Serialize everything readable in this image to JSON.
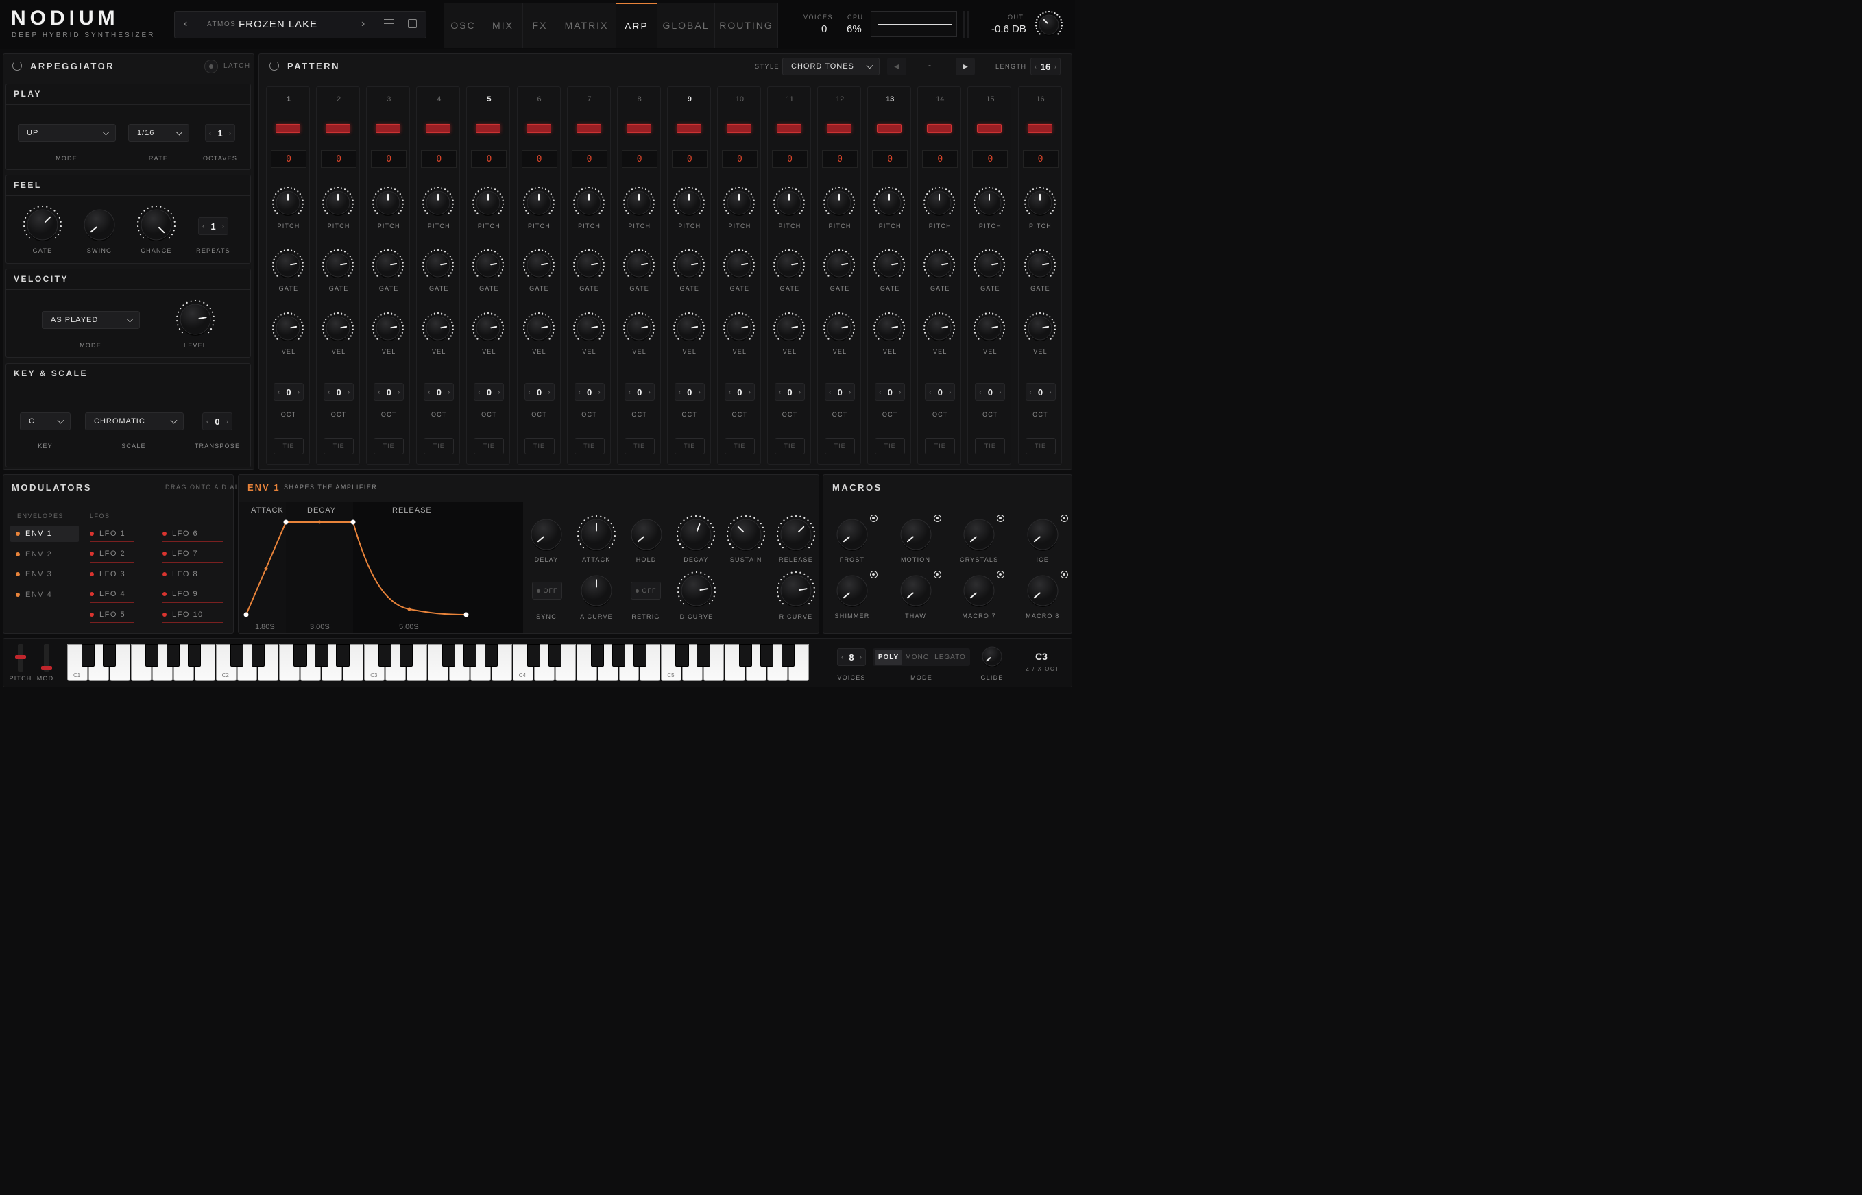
{
  "app": {
    "logo": "NODIUM",
    "subtitle": "DEEP HYBRID SYNTHESIZER"
  },
  "preset": {
    "category": "ATMOS",
    "name": "FROZEN LAKE"
  },
  "nav": {
    "tabs": [
      "OSC",
      "MIX",
      "FX",
      "MATRIX",
      "ARP",
      "GLOBAL",
      "ROUTING"
    ],
    "active": "ARP"
  },
  "meters": {
    "voices_label": "VOICES",
    "voices": "0",
    "cpu_label": "CPU",
    "cpu": "6%",
    "out_label": "OUT",
    "out": "-0.6 DB"
  },
  "arp": {
    "title": "ARPEGGIATOR",
    "latch": "LATCH",
    "play": {
      "title": "PLAY",
      "mode": "UP",
      "rate": "1/16",
      "octaves": "1",
      "mode_label": "MODE",
      "rate_label": "RATE",
      "octaves_label": "OCTAVES"
    },
    "feel": {
      "title": "FEEL",
      "gate": "GATE",
      "swing": "SWING",
      "chance": "CHANCE",
      "repeats": "1",
      "repeats_label": "REPEATS"
    },
    "velocity": {
      "title": "VELOCITY",
      "mode": "AS PLAYED",
      "mode_label": "MODE",
      "level_label": "LEVEL"
    },
    "key_scale": {
      "title": "KEY & SCALE",
      "key": "C",
      "scale": "CHROMATIC",
      "transpose": "0",
      "key_label": "KEY",
      "scale_label": "SCALE",
      "transpose_label": "TRANSPOSE"
    }
  },
  "pattern": {
    "title": "PATTERN",
    "style_label": "STYLE",
    "style": "CHORD TONES",
    "nav_value": "-",
    "length_label": "LENGTH",
    "length": "16",
    "step_labels": {
      "pitch": "PITCH",
      "gate": "GATE",
      "vel": "VEL",
      "oct": "OCT",
      "tie": "TIE"
    },
    "steps": [
      "1",
      "2",
      "3",
      "4",
      "5",
      "6",
      "7",
      "8",
      "9",
      "10",
      "11",
      "12",
      "13",
      "14",
      "15",
      "16"
    ],
    "bright_steps": [
      "1",
      "5",
      "9",
      "13"
    ],
    "note_value": "0",
    "oct_value": "0"
  },
  "modulators": {
    "title": "MODULATORS",
    "hint": "DRAG ONTO A DIAL",
    "envelopes_label": "ENVELOPES",
    "lfos_label": "LFOS",
    "envelopes": [
      "ENV 1",
      "ENV 2",
      "ENV 3",
      "ENV 4"
    ],
    "lfos_a": [
      "LFO 1",
      "LFO 2",
      "LFO 3",
      "LFO 4",
      "LFO 5"
    ],
    "lfos_b": [
      "LFO 6",
      "LFO 7",
      "LFO 8",
      "LFO 9",
      "LFO 10"
    ]
  },
  "env": {
    "title": "ENV 1",
    "subtitle": "SHAPES THE AMPLIFIER",
    "graph": {
      "attack": "ATTACK",
      "decay": "DECAY",
      "release": "RELEASE",
      "t1": "1.80S",
      "t2": "3.00S",
      "t3": "5.00S"
    },
    "knobs": [
      "DELAY",
      "ATTACK",
      "HOLD",
      "DECAY",
      "SUSTAIN",
      "RELEASE"
    ],
    "sync": "SYNC",
    "sync_state": "OFF",
    "a_curve": "A CURVE",
    "retrig": "RETRIG",
    "retrig_state": "OFF",
    "d_curve": "D CURVE",
    "r_curve": "R CURVE"
  },
  "macros": {
    "title": "MACROS",
    "names": [
      "FROST",
      "MOTION",
      "CRYSTALS",
      "ICE",
      "SHIMMER",
      "THAW",
      "MACRO 7",
      "MACRO 8"
    ]
  },
  "keyboard": {
    "pitch_label": "PITCH",
    "mod_label": "MOD",
    "octave_labels": [
      "C1",
      "C2",
      "C3",
      "C4",
      "C5"
    ],
    "voices": "8",
    "voices_label": "VOICES",
    "modes": [
      "POLY",
      "MONO",
      "LEGATO"
    ],
    "mode_label": "MODE",
    "glide_label": "GLIDE",
    "octave": "C3",
    "octave_hint": "Z / X OCT"
  },
  "colors": {
    "accent": "#e8833a",
    "red": "#c0262c",
    "lfo_red": "#d9342f"
  }
}
